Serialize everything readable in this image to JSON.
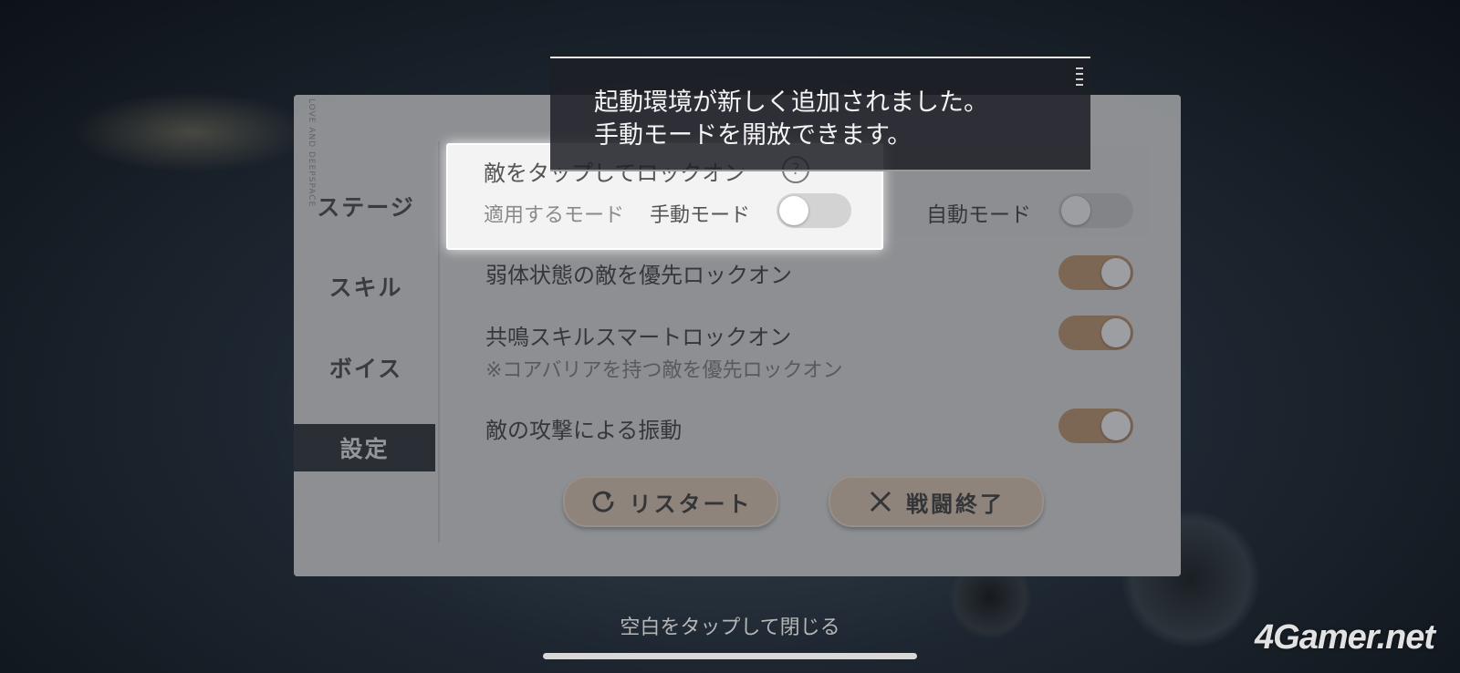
{
  "notification": {
    "line1": "起動環境が新しく追加されました。",
    "line2": "手動モードを開放できます。"
  },
  "sidebar": {
    "brand": "LOVE AND DEEPSPACE",
    "items": [
      {
        "label": "ステージ",
        "active": false
      },
      {
        "label": "スキル",
        "active": false
      },
      {
        "label": "ボイス",
        "active": false
      },
      {
        "label": "設定",
        "active": true
      }
    ]
  },
  "settings": {
    "tap_lockon": {
      "title": "敵をタップしてロックオン",
      "help_icon": "?",
      "mode_label": "適用するモード",
      "manual_mode_label": "手動モード",
      "manual_mode_enabled": false,
      "auto_mode_label": "自動モード",
      "auto_mode_enabled": false
    },
    "weak_priority": {
      "label": "弱体状態の敵を優先ロックオン",
      "enabled": true
    },
    "resonance_smart": {
      "label": "共鳴スキルスマートロックオン",
      "note": "※コアバリアを持つ敵を優先ロックオン",
      "enabled": true
    },
    "vibration": {
      "label": "敵の攻撃による振動",
      "enabled": true
    }
  },
  "buttons": {
    "restart": {
      "label": "リスタート",
      "icon": "restart-icon"
    },
    "end_battle": {
      "label": "戦闘終了",
      "icon": "close-icon"
    }
  },
  "footer": {
    "tap_to_close": "空白をタップして閉じる"
  },
  "watermark": "4Gamer.net",
  "colors": {
    "toggle_on": "#c9a07d",
    "toggle_off": "#d3d3d3",
    "button_bg": "#e9d2be",
    "active_tab_bg": "#3c4046"
  }
}
